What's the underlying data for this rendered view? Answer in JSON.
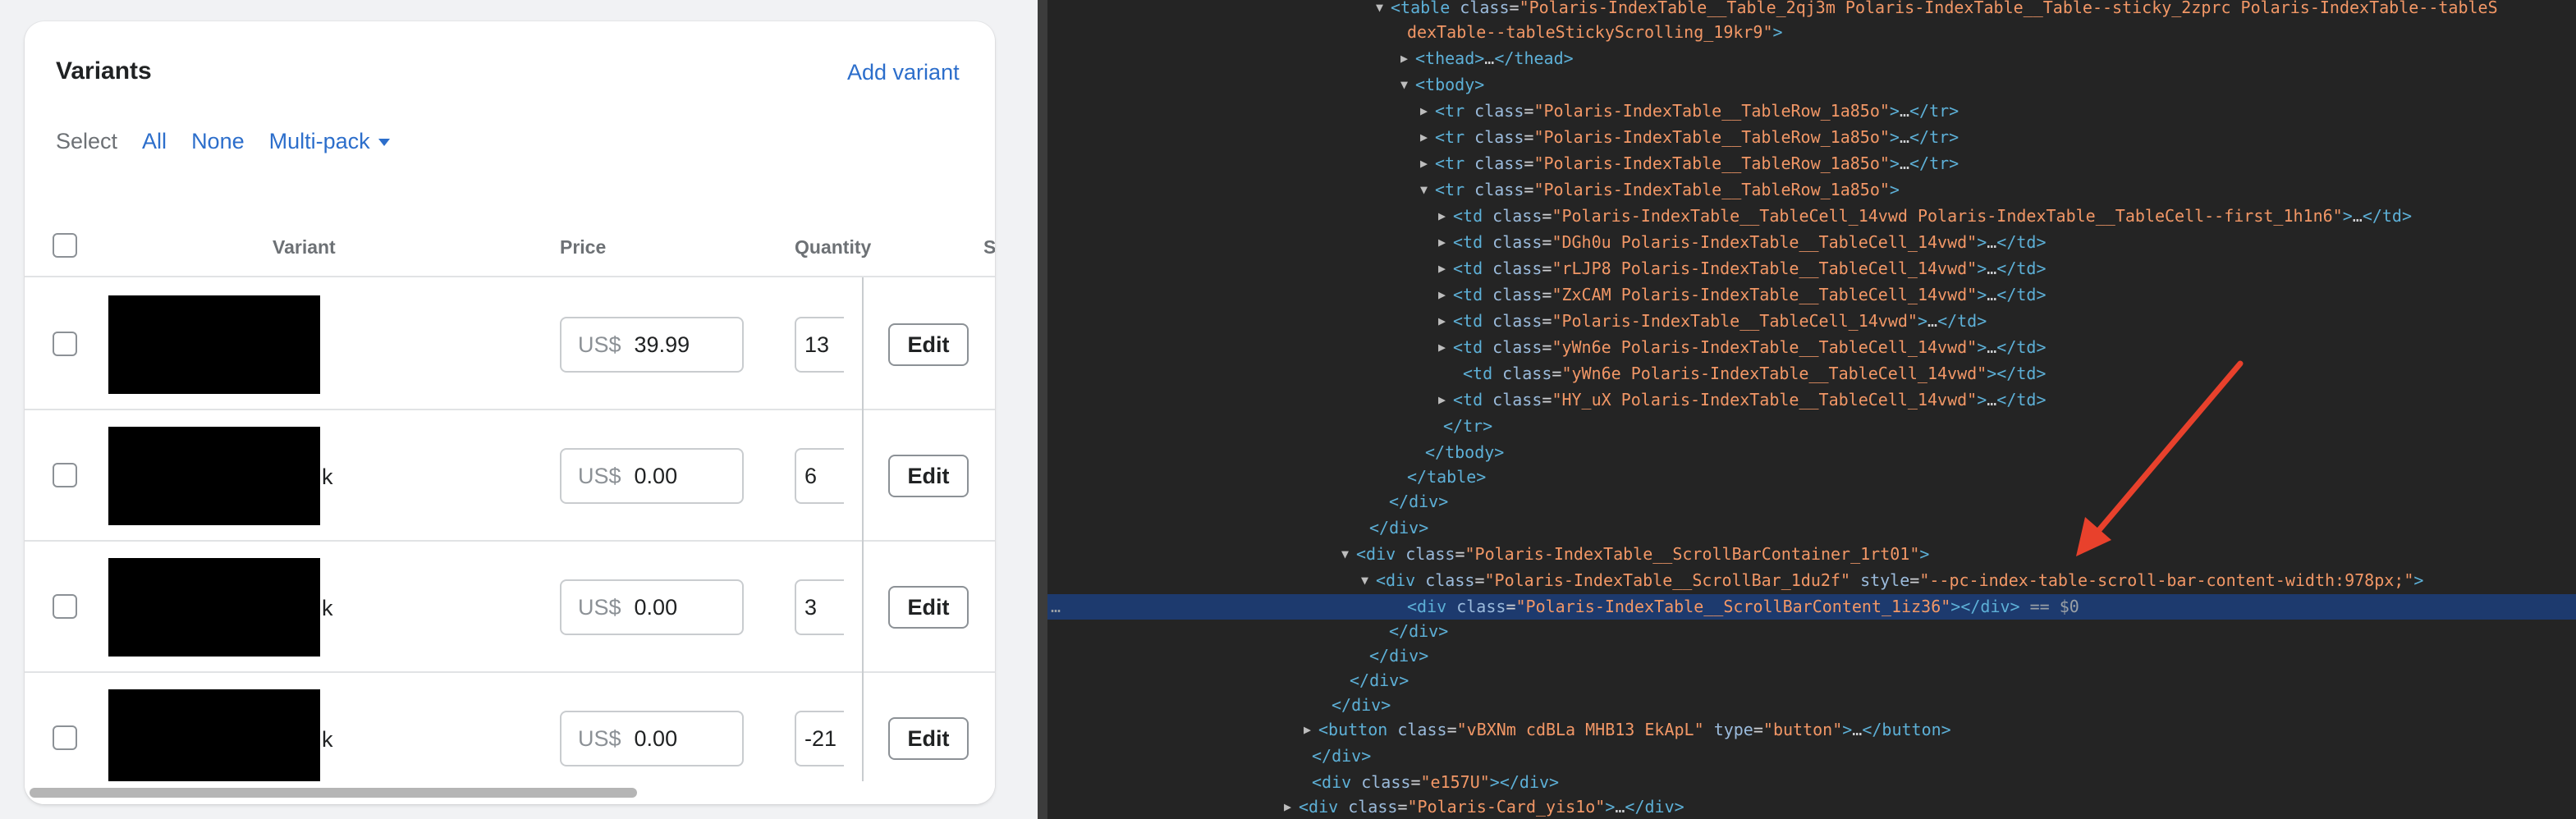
{
  "card": {
    "title": "Variants",
    "add_variant": "Add variant",
    "select_label": "Select",
    "select_all": "All",
    "select_none": "None",
    "select_multipack": "Multi-pack",
    "columns": {
      "variant": "Variant",
      "price": "Price",
      "quantity": "Quantity",
      "cutoff": "S"
    },
    "rows": [
      {
        "currency": "US$",
        "price": "39.99",
        "quantity": "13",
        "edit": "Edit",
        "name_tail": ""
      },
      {
        "currency": "US$",
        "price": "0.00",
        "quantity": "6",
        "edit": "Edit",
        "name_tail": "k"
      },
      {
        "currency": "US$",
        "price": "0.00",
        "quantity": "3",
        "edit": "Edit",
        "name_tail": "k"
      },
      {
        "currency": "US$",
        "price": "0.00",
        "quantity": "-21",
        "edit": "Edit",
        "name_tail": "k"
      }
    ]
  },
  "devtools": {
    "lines": [
      {
        "tri": "▼",
        "html": "<span class=\"tag\">&lt;table</span> <span class=\"attr\">class</span>=<span class=\"str\">\"Polaris-IndexTable__Table_2qj3m Polaris-IndexTable__Table--sticky_2zprc Polaris-IndexTable--tableS</span>"
      },
      {
        "tri": "",
        "html": "<span class=\"str\">dexTable--tableStickyScrolling_19kr9\"</span><span class=\"tag\">&gt;</span>"
      },
      {
        "tri": "▶",
        "html": "<span class=\"tag\">&lt;thead&gt;</span><span class=\"ell\">…</span><span class=\"tag\">&lt;/thead&gt;</span>"
      },
      {
        "tri": "▼",
        "html": "<span class=\"tag\">&lt;tbody&gt;</span>"
      },
      {
        "tri": "▶",
        "html": "<span class=\"tag\">&lt;tr</span> <span class=\"attr\">class</span>=<span class=\"str\">\"Polaris-IndexTable__TableRow_1a85o\"</span><span class=\"tag\">&gt;</span><span class=\"ell\">…</span><span class=\"tag\">&lt;/tr&gt;</span>"
      },
      {
        "tri": "▶",
        "html": "<span class=\"tag\">&lt;tr</span> <span class=\"attr\">class</span>=<span class=\"str\">\"Polaris-IndexTable__TableRow_1a85o\"</span><span class=\"tag\">&gt;</span><span class=\"ell\">…</span><span class=\"tag\">&lt;/tr&gt;</span>"
      },
      {
        "tri": "▶",
        "html": "<span class=\"tag\">&lt;tr</span> <span class=\"attr\">class</span>=<span class=\"str\">\"Polaris-IndexTable__TableRow_1a85o\"</span><span class=\"tag\">&gt;</span><span class=\"ell\">…</span><span class=\"tag\">&lt;/tr&gt;</span>"
      },
      {
        "tri": "▼",
        "html": "<span class=\"tag\">&lt;tr</span> <span class=\"attr\">class</span>=<span class=\"str\">\"Polaris-IndexTable__TableRow_1a85o\"</span><span class=\"tag\">&gt;</span>"
      },
      {
        "tri": "▶",
        "html": "<span class=\"tag\">&lt;td</span> <span class=\"attr\">class</span>=<span class=\"str\">\"Polaris-IndexTable__TableCell_14vwd Polaris-IndexTable__TableCell--first_1h1n6\"</span><span class=\"tag\">&gt;</span><span class=\"ell\">…</span><span class=\"tag\">&lt;/td&gt;</span>"
      },
      {
        "tri": "▶",
        "html": "<span class=\"tag\">&lt;td</span> <span class=\"attr\">class</span>=<span class=\"str\">\"DGh0u Polaris-IndexTable__TableCell_14vwd\"</span><span class=\"tag\">&gt;</span><span class=\"ell\">…</span><span class=\"tag\">&lt;/td&gt;</span>"
      },
      {
        "tri": "▶",
        "html": "<span class=\"tag\">&lt;td</span> <span class=\"attr\">class</span>=<span class=\"str\">\"rLJP8 Polaris-IndexTable__TableCell_14vwd\"</span><span class=\"tag\">&gt;</span><span class=\"ell\">…</span><span class=\"tag\">&lt;/td&gt;</span>"
      },
      {
        "tri": "▶",
        "html": "<span class=\"tag\">&lt;td</span> <span class=\"attr\">class</span>=<span class=\"str\">\"ZxCAM Polaris-IndexTable__TableCell_14vwd\"</span><span class=\"tag\">&gt;</span><span class=\"ell\">…</span><span class=\"tag\">&lt;/td&gt;</span>"
      },
      {
        "tri": "▶",
        "html": "<span class=\"tag\">&lt;td</span> <span class=\"attr\">class</span>=<span class=\"str\">\"Polaris-IndexTable__TableCell_14vwd\"</span><span class=\"tag\">&gt;</span><span class=\"ell\">…</span><span class=\"tag\">&lt;/td&gt;</span>"
      },
      {
        "tri": "▶",
        "html": "<span class=\"tag\">&lt;td</span> <span class=\"attr\">class</span>=<span class=\"str\">\"yWn6e Polaris-IndexTable__TableCell_14vwd\"</span><span class=\"tag\">&gt;</span><span class=\"ell\">…</span><span class=\"tag\">&lt;/td&gt;</span>"
      },
      {
        "tri": "",
        "html": "<span class=\"tag\">&lt;td</span> <span class=\"attr\">class</span>=<span class=\"str\">\"yWn6e Polaris-IndexTable__TableCell_14vwd\"</span><span class=\"tag\">&gt;&lt;/td&gt;</span>"
      },
      {
        "tri": "▶",
        "html": "<span class=\"tag\">&lt;td</span> <span class=\"attr\">class</span>=<span class=\"str\">\"HY_uX Polaris-IndexTable__TableCell_14vwd\"</span><span class=\"tag\">&gt;</span><span class=\"ell\">…</span><span class=\"tag\">&lt;/td&gt;</span>"
      },
      {
        "tri": "",
        "html": "<span class=\"tag\">&lt;/tr&gt;</span>"
      },
      {
        "tri": "",
        "html": "<span class=\"tag\">&lt;/tbody&gt;</span>"
      },
      {
        "tri": "",
        "html": "<span class=\"tag\">&lt;/table&gt;</span>"
      },
      {
        "tri": "",
        "html": "<span class=\"tag\">&lt;/div&gt;</span>"
      },
      {
        "tri": "",
        "html": "<span class=\"tag\">&lt;/div&gt;</span>"
      },
      {
        "tri": "▼",
        "html": "<span class=\"tag\">&lt;div</span> <span class=\"attr\">class</span>=<span class=\"str\">\"Polaris-IndexTable__ScrollBarContainer_1rt01\"</span><span class=\"tag\">&gt;</span>"
      },
      {
        "tri": "▼",
        "html": "<span class=\"tag\">&lt;div</span> <span class=\"attr\">class</span>=<span class=\"str\">\"Polaris-IndexTable__ScrollBar_1du2f\"</span> <span class=\"attr\">style</span>=<span class=\"str\">\"--pc-index-table-scroll-bar-content-width:978px;\"</span><span class=\"tag\">&gt;</span>"
      },
      {
        "tri": "",
        "html": "<span class=\"tag\">&lt;div</span> <span class=\"attr\">class</span>=<span class=\"str\">\"Polaris-IndexTable__ScrollBarContent_1iz36\"</span><span class=\"tag\">&gt;&lt;/div&gt;</span> <span class=\"dim\">== $0</span>"
      },
      {
        "tri": "",
        "html": "<span class=\"tag\">&lt;/div&gt;</span>"
      },
      {
        "tri": "",
        "html": "<span class=\"tag\">&lt;/div&gt;</span>"
      },
      {
        "tri": "",
        "html": "<span class=\"tag\">&lt;/div&gt;</span>"
      },
      {
        "tri": "",
        "html": "<span class=\"tag\">&lt;/div&gt;</span>"
      },
      {
        "tri": "▶",
        "html": "<span class=\"tag\">&lt;button</span> <span class=\"attr\">class</span>=<span class=\"str\">\"vBXNm cdBLa MHB13 EkApL\"</span> <span class=\"attr\">type</span>=<span class=\"str\">\"button\"</span><span class=\"tag\">&gt;</span><span class=\"ell\">…</span><span class=\"tag\">&lt;/button&gt;</span>"
      },
      {
        "tri": "",
        "html": "<span class=\"tag\">&lt;/div&gt;</span>"
      },
      {
        "tri": "",
        "html": "<span class=\"tag\">&lt;div</span> <span class=\"attr\">class</span>=<span class=\"str\">\"e157U\"</span><span class=\"tag\">&gt;&lt;/div&gt;</span>"
      },
      {
        "tri": "▶",
        "html": "<span class=\"tag\">&lt;div</span> <span class=\"attr\">class</span>=<span class=\"str\">\"Polaris-Card_yis1o\"</span><span class=\"tag\">&gt;</span><span class=\"ell\">…</span><span class=\"tag\">&lt;/div&gt;</span>"
      }
    ],
    "selected_line_marker": "…",
    "arrow_color": "#e8412c"
  },
  "colors": {
    "link": "#2c6ecb",
    "devtools_bg": "#242424",
    "selected_bg": "#1d3a6e"
  }
}
